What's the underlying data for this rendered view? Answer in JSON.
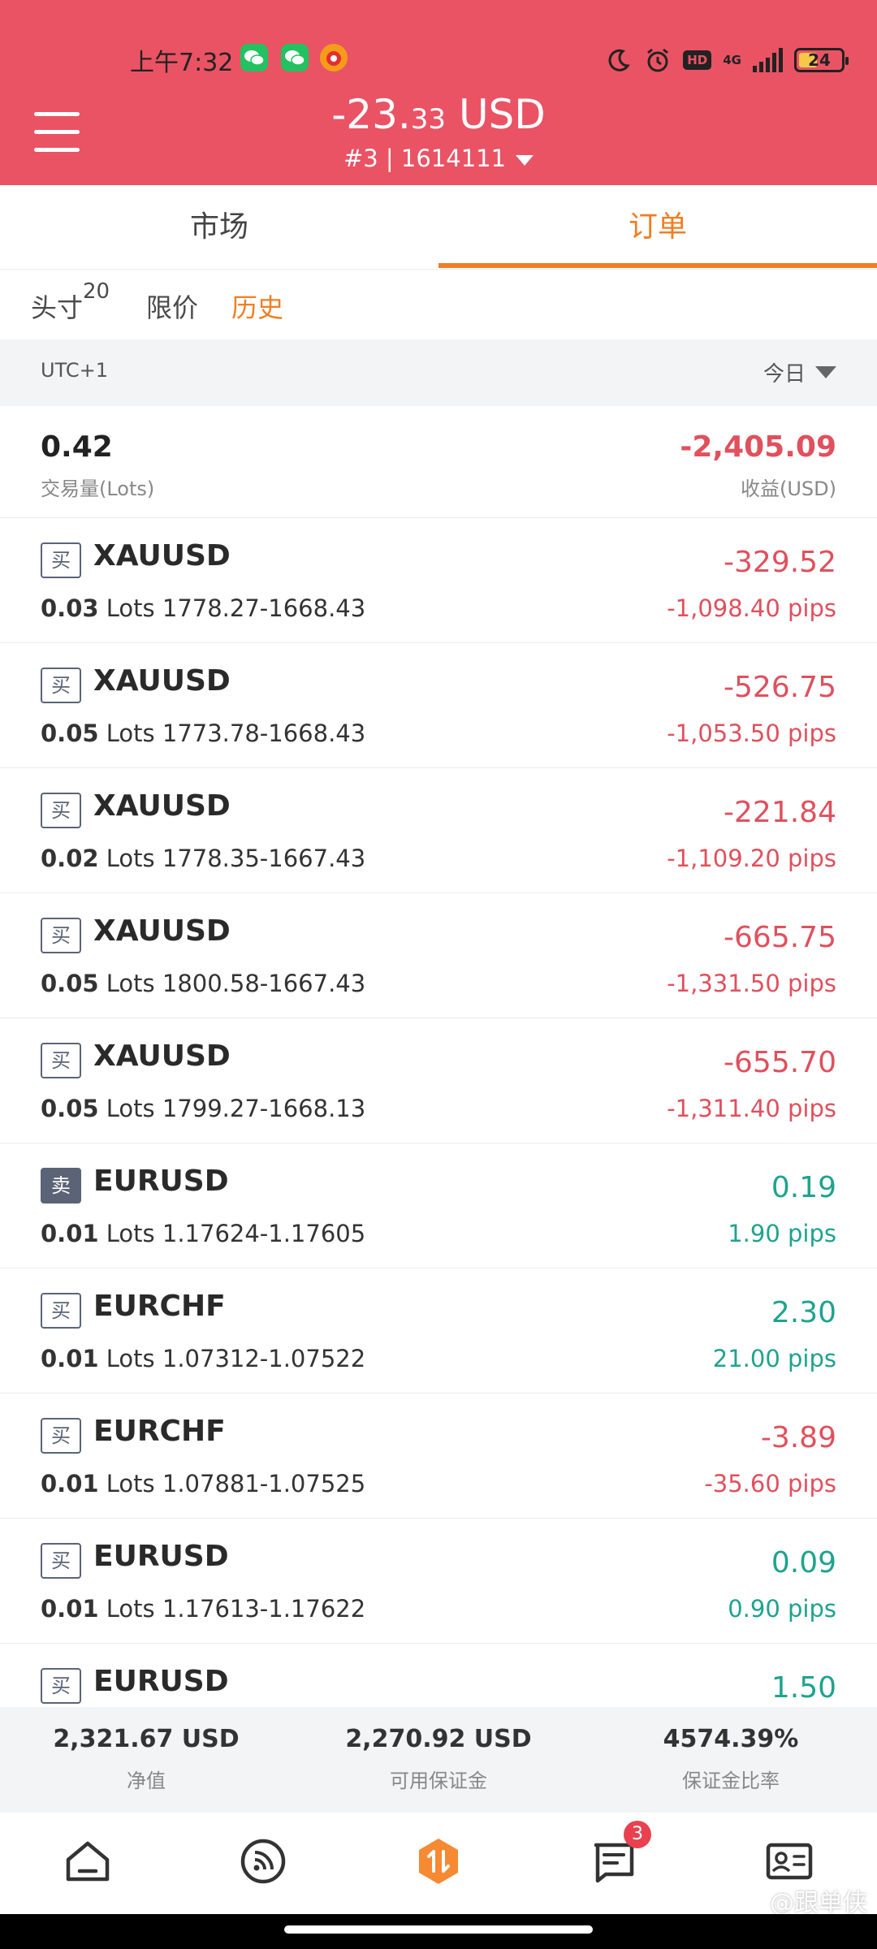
{
  "status_bar": {
    "time": "上午7:32",
    "hd": "HD",
    "network": "4G",
    "battery": "24"
  },
  "header": {
    "balance_main": "-23.",
    "balance_decimal": "33",
    "balance_currency": " USD",
    "account": "#3 | 1614111"
  },
  "tabs": [
    {
      "label": "市场",
      "active": false
    },
    {
      "label": "订单",
      "active": true
    }
  ],
  "subtabs": {
    "positions_label": "头寸",
    "positions_count": "20",
    "pending_label": "限价",
    "history_label": "历史"
  },
  "filter": {
    "timezone": "UTC+1",
    "period": "今日"
  },
  "summary": {
    "volume": "0.42",
    "volume_label": "交易量(Lots)",
    "profit": "-2,405.09",
    "profit_label": "收益(USD)"
  },
  "orders": [
    {
      "side": "买",
      "symbol": "XAUUSD",
      "lots": "0.03",
      "lots_unit": "Lots",
      "prices": "1778.27-1668.43",
      "profit": "-329.52",
      "pips": "-1,098.40 pips"
    },
    {
      "side": "买",
      "symbol": "XAUUSD",
      "lots": "0.05",
      "lots_unit": "Lots",
      "prices": "1773.78-1668.43",
      "profit": "-526.75",
      "pips": "-1,053.50 pips"
    },
    {
      "side": "买",
      "symbol": "XAUUSD",
      "lots": "0.02",
      "lots_unit": "Lots",
      "prices": "1778.35-1667.43",
      "profit": "-221.84",
      "pips": "-1,109.20 pips"
    },
    {
      "side": "买",
      "symbol": "XAUUSD",
      "lots": "0.05",
      "lots_unit": "Lots",
      "prices": "1800.58-1667.43",
      "profit": "-665.75",
      "pips": "-1,331.50 pips"
    },
    {
      "side": "买",
      "symbol": "XAUUSD",
      "lots": "0.05",
      "lots_unit": "Lots",
      "prices": "1799.27-1668.13",
      "profit": "-655.70",
      "pips": "-1,311.40 pips"
    },
    {
      "side": "卖",
      "symbol": "EURUSD",
      "lots": "0.01",
      "lots_unit": "Lots",
      "prices": "1.17624-1.17605",
      "profit": "0.19",
      "pips": "1.90 pips"
    },
    {
      "side": "买",
      "symbol": "EURCHF",
      "lots": "0.01",
      "lots_unit": "Lots",
      "prices": "1.07312-1.07522",
      "profit": "2.30",
      "pips": "21.00 pips"
    },
    {
      "side": "买",
      "symbol": "EURCHF",
      "lots": "0.01",
      "lots_unit": "Lots",
      "prices": "1.07881-1.07525",
      "profit": "-3.89",
      "pips": "-35.60 pips"
    },
    {
      "side": "买",
      "symbol": "EURUSD",
      "lots": "0.01",
      "lots_unit": "Lots",
      "prices": "1.17613-1.17622",
      "profit": "0.09",
      "pips": "0.90 pips"
    },
    {
      "side": "买",
      "symbol": "EURUSD",
      "lots": "",
      "lots_unit": "",
      "prices": "",
      "profit": "1.50",
      "pips": ""
    }
  ],
  "footer_stats": {
    "equity_value": "2,321.67 USD",
    "equity_label": "净值",
    "free_margin_value": "2,270.92 USD",
    "free_margin_label": "可用保证金",
    "margin_level_value": "4574.39%",
    "margin_level_label": "保证金比率"
  },
  "bottom_nav": {
    "messages_badge": "3",
    "watermark": "@跟单侠"
  },
  "colors": {
    "header_bg": "#ea5364",
    "accent": "#f07e22",
    "negative": "#e0505d",
    "positive": "#1fa38e"
  },
  "icons": [
    "menu-icon",
    "dropdown-icon",
    "home-icon",
    "feed-icon",
    "trade-icon",
    "messages-icon",
    "profile-icon",
    "alarm-icon",
    "moon-icon"
  ]
}
